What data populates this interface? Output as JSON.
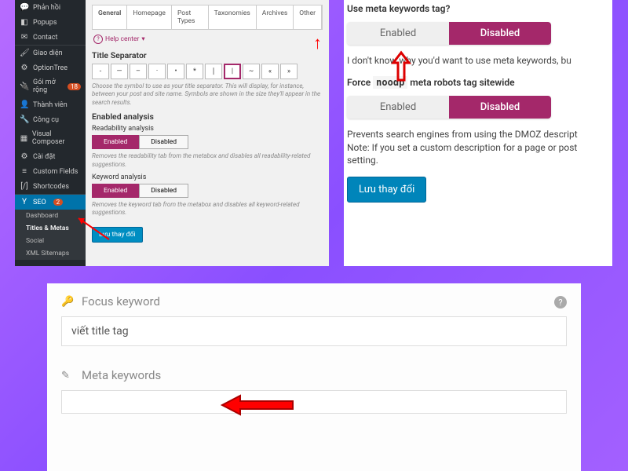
{
  "panel1": {
    "sidebar": {
      "items": [
        {
          "icon": "💬",
          "label": "Phản hồi"
        },
        {
          "icon": "◧",
          "label": "Popups"
        },
        {
          "icon": "✉",
          "label": "Contact"
        },
        {
          "icon": "🖌",
          "label": "Giao diện"
        },
        {
          "icon": "⚙",
          "label": "OptionTree"
        },
        {
          "icon": "🔌",
          "label": "Gói mở rộng",
          "badge": "18"
        },
        {
          "icon": "👤",
          "label": "Thành viên"
        },
        {
          "icon": "🔧",
          "label": "Công cụ"
        },
        {
          "icon": "▦",
          "label": "Visual Composer"
        },
        {
          "icon": "⚙",
          "label": "Cài đặt"
        },
        {
          "icon": "≡",
          "label": "Custom Fields"
        },
        {
          "icon": "[/]",
          "label": "Shortcodes"
        }
      ],
      "seo": {
        "label": "SEO",
        "badge": "2"
      },
      "subs": [
        "Dashboard",
        "Titles & Metas",
        "Social",
        "XML Sitemaps"
      ]
    },
    "tabs": [
      "General",
      "Homepage",
      "Post Types",
      "Taxonomies",
      "Archives",
      "Other"
    ],
    "help_center": "Help center",
    "title_separator": "Title Separator",
    "separators": [
      "-",
      "—",
      "–",
      "·",
      "•",
      "*",
      "❘",
      "|",
      "~",
      "«",
      "»"
    ],
    "sep_help": "Choose the symbol to use as your title separator. This will display, for instance, between your post and site name. Symbols are shown in the size they'll appear in the search results.",
    "enabled_analysis": "Enabled analysis",
    "readability": "Readability analysis",
    "read_help": "Removes the readability tab from the metabox and disables all readability-related suggestions.",
    "keyword": "Keyword analysis",
    "keyword_help": "Removes the keyword tab from the metabox and disables all keyword-related suggestions.",
    "enabled": "Enabled",
    "disabled": "Disabled",
    "save": "Lưu thay đổi"
  },
  "panel2": {
    "q1": "Use meta keywords tag?",
    "enabled": "Enabled",
    "disabled": "Disabled",
    "text1": "I don't know why you'd want to use meta keywords, bu",
    "q2_pre": "Force",
    "q2_code": "noodp",
    "q2_post": "meta robots tag sitewide",
    "text2a": "Prevents search engines from using the DMOZ descript",
    "text2b": "Note: If you set a custom description for a page or post",
    "text2c": "setting.",
    "save": "Lưu thay đổi"
  },
  "panel3": {
    "focus_label": "Focus keyword",
    "input_value": "viết title tag",
    "meta_label": "Meta keywords"
  }
}
